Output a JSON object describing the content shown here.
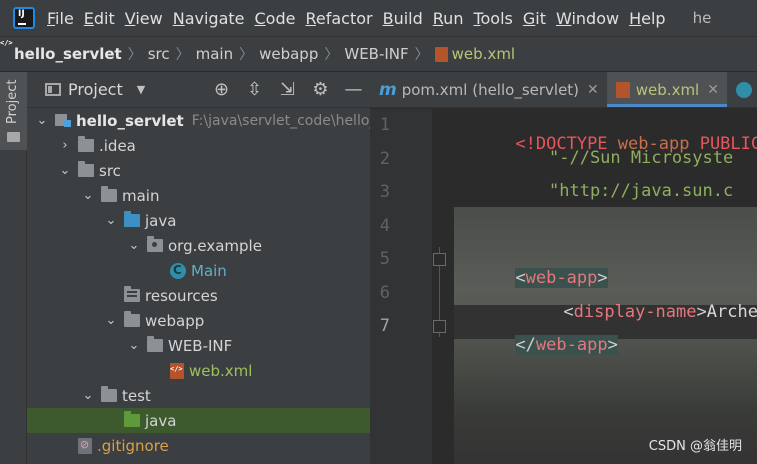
{
  "menubar": {
    "items": [
      {
        "mnemonic": "F",
        "rest": "ile"
      },
      {
        "mnemonic": "E",
        "rest": "dit"
      },
      {
        "mnemonic": "V",
        "rest": "iew"
      },
      {
        "mnemonic": "N",
        "rest": "avigate"
      },
      {
        "mnemonic": "C",
        "rest": "ode"
      },
      {
        "mnemonic": "R",
        "rest": "efactor"
      },
      {
        "mnemonic": "B",
        "rest": "uild"
      },
      {
        "mnemonic": "R",
        "rest": "un"
      },
      {
        "mnemonic": "T",
        "rest": "ools"
      },
      {
        "mnemonic": "G",
        "rest": "it"
      },
      {
        "mnemonic": "W",
        "rest": "indow"
      },
      {
        "mnemonic": "H",
        "rest": "elp"
      }
    ],
    "title_fragment": "he"
  },
  "breadcrumb": [
    "hello_servlet",
    "src",
    "main",
    "webapp",
    "WEB-INF",
    "web.xml"
  ],
  "side_strip": {
    "label": "Project"
  },
  "project_panel": {
    "title": "Project",
    "tools": {
      "locate": "⊕",
      "expand": "⇳",
      "collapse": "⇲",
      "settings": "⚙",
      "hide": "—"
    }
  },
  "tree": [
    {
      "label": "hello_servlet",
      "path": "F:\\java\\servlet_code\\hello_"
    },
    {
      "label": ".idea"
    },
    {
      "label": "src"
    },
    {
      "label": "main"
    },
    {
      "label": "java"
    },
    {
      "label": "org.example"
    },
    {
      "label": "Main"
    },
    {
      "label": "resources"
    },
    {
      "label": "webapp"
    },
    {
      "label": "WEB-INF"
    },
    {
      "label": "web.xml"
    },
    {
      "label": "test"
    },
    {
      "label": "java"
    },
    {
      "label": ".gitignore"
    }
  ],
  "tabs": [
    {
      "label": "pom.xml (hello_servlet)"
    },
    {
      "label": "web.xml"
    }
  ],
  "editor": {
    "line_numbers": [
      "1",
      "2",
      "3",
      "4",
      "5",
      "6",
      "7"
    ],
    "line1": {
      "doctype": "<!DOCTYPE",
      "name": "web-app",
      "public": "PUBLIC"
    },
    "line2": "\"-//Sun Microsyste",
    "line3": "\"http://java.sun.c",
    "line5": {
      "open": "<",
      "tag": "web-app",
      "close": ">"
    },
    "line6": {
      "open": "<",
      "tag": "display-name",
      "close": ">",
      "text": "Archetyp"
    },
    "line7": {
      "open": "</",
      "tag": "web-app",
      "close": ">"
    }
  },
  "watermark": "CSDN @翁佳明"
}
